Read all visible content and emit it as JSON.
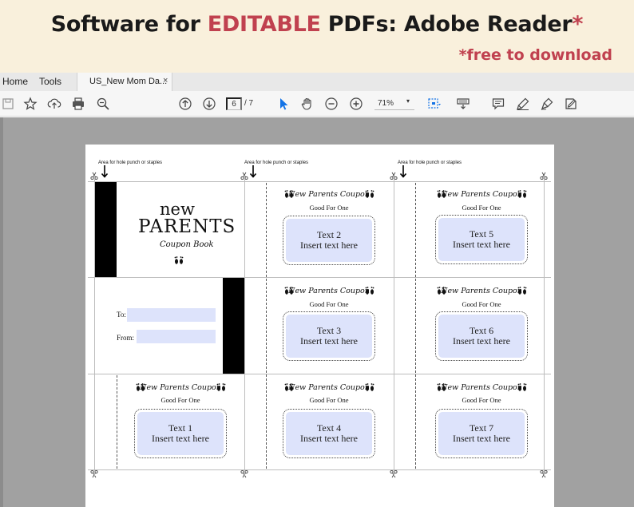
{
  "banner": {
    "title_before": "Software for ",
    "title_highlight": "EDITABLE",
    "title_after": " PDFs: Adobe Reader",
    "title_star": "*",
    "subtitle": "*free to download",
    "accent_color": "#c0414f"
  },
  "menu": {
    "home": "Home",
    "tools": "Tools"
  },
  "tab": {
    "label": "US_New Mom Da...",
    "close": "×"
  },
  "toolbar": {
    "icons": [
      "save-icon",
      "star-icon",
      "upload-icon",
      "print-icon",
      "search-zoom-icon",
      "page-up-icon",
      "page-down-icon",
      "select-cursor-icon",
      "hand-icon",
      "zoom-out-icon",
      "zoom-in-icon",
      "marquee-zoom-icon",
      "read-mode-icon",
      "comment-icon",
      "highlight-icon",
      "sign-icon",
      "fill-sign-icon"
    ],
    "current_page": "6",
    "page_total": "/ 7",
    "zoom": "71%",
    "zoom_caret": "▾"
  },
  "document": {
    "punch_text": "Area for hole punch or staples",
    "cover": {
      "line1": "new",
      "line2": "PARENTS",
      "line3": "Coupon Book"
    },
    "to_label": "To:",
    "from_label": "From:",
    "coupon_heading": "New Parents Coupon",
    "good_for": "Good For One",
    "coupons": [
      {
        "title": "Text 1",
        "body": "Insert text here"
      },
      {
        "title": "Text 2",
        "body": "Insert text here"
      },
      {
        "title": "Text 3",
        "body": "Insert text here"
      },
      {
        "title": "Text 4",
        "body": "Insert text here"
      },
      {
        "title": "Text 5",
        "body": "Insert text here"
      },
      {
        "title": "Text 6",
        "body": "Insert text here"
      },
      {
        "title": "Text 7",
        "body": "Insert text here"
      }
    ],
    "field_color": "#dde3fb"
  }
}
